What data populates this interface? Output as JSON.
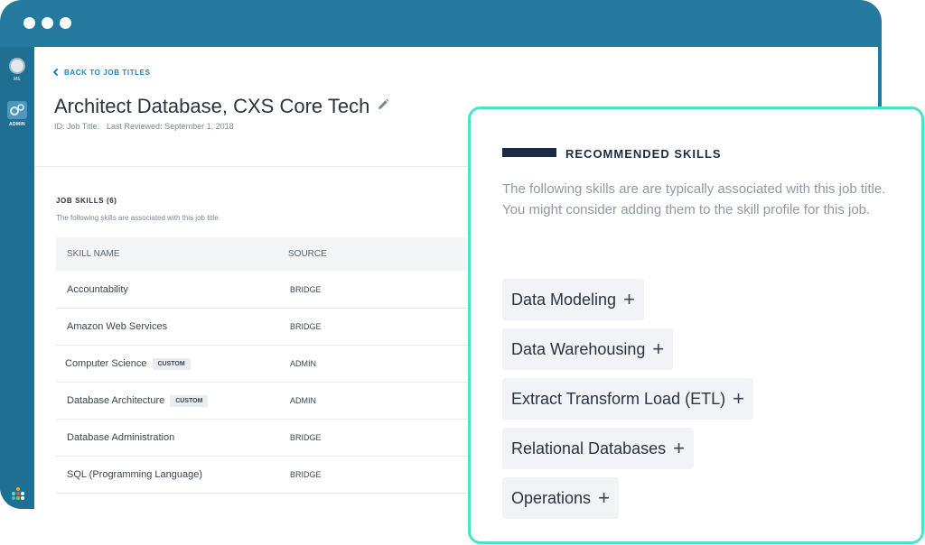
{
  "sidebar": {
    "items": [
      {
        "label": "ME",
        "icon": "avatar-icon"
      },
      {
        "label": "ADMIN",
        "icon": "gear-icon"
      }
    ]
  },
  "header": {
    "back_link": "BACK TO JOB TITLES",
    "title": "Architect Database, CXS Core Tech",
    "meta_id": "ID: Job Title.",
    "meta_reviewed": "Last Reviewed: September 1, 2018"
  },
  "job_skills": {
    "title": "JOB SKILLS (6)",
    "subtitle": "The following skills are associated with this job title",
    "columns": [
      "SKILL NAME",
      "SOURCE"
    ],
    "rows": [
      {
        "name": "Accountability",
        "badge": "",
        "source": "BRIDGE"
      },
      {
        "name": "Amazon Web Services",
        "badge": "",
        "source": "BRIDGE"
      },
      {
        "name": "Computer Science",
        "badge": "CUSTOM",
        "source": "ADMIN"
      },
      {
        "name": "Database Architecture",
        "badge": "CUSTOM",
        "source": "ADMIN"
      },
      {
        "name": "Database Administration",
        "badge": "",
        "source": "BRIDGE"
      },
      {
        "name": "SQL (Programming Language)",
        "badge": "",
        "source": "BRIDGE"
      }
    ]
  },
  "recommended": {
    "title": "RECOMMENDED SKILLS",
    "description": "The following skills are are typically associated with this job title. You might consider adding them to the skill profile for this job.",
    "skills": [
      "Data Modeling",
      "Data Warehousing",
      "Extract Transform Load (ETL)",
      "Relational Databases",
      "Operations"
    ],
    "add_symbol": "+"
  },
  "colors": {
    "window_frame": "#25799e",
    "accent_link": "#1d84c0",
    "panel_border": "#4fe0c8",
    "panel_heading": "#1b2a47"
  }
}
